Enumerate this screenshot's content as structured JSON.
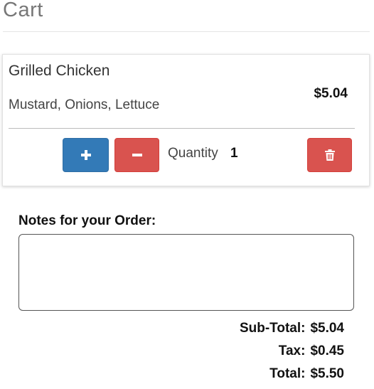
{
  "page": {
    "title": "Cart"
  },
  "cart": {
    "items": [
      {
        "name": "Grilled Chicken",
        "toppings": "Mustard, Onions, Lettuce",
        "price": "$5.04",
        "quantity_label": "Quantity",
        "quantity": "1"
      }
    ]
  },
  "buttons": {
    "increase_icon": "plus-icon",
    "decrease_icon": "minus-icon",
    "delete_icon": "trash-icon"
  },
  "notes": {
    "label": "Notes for your Order:",
    "value": "",
    "placeholder": ""
  },
  "totals": {
    "subtotal_label": "Sub-Total:",
    "subtotal": "$5.04",
    "tax_label": "Tax:",
    "tax": "$0.45",
    "total_label": "Total:",
    "total": "$5.50"
  },
  "colors": {
    "primary": "#337ab7",
    "danger": "#d9534f"
  }
}
